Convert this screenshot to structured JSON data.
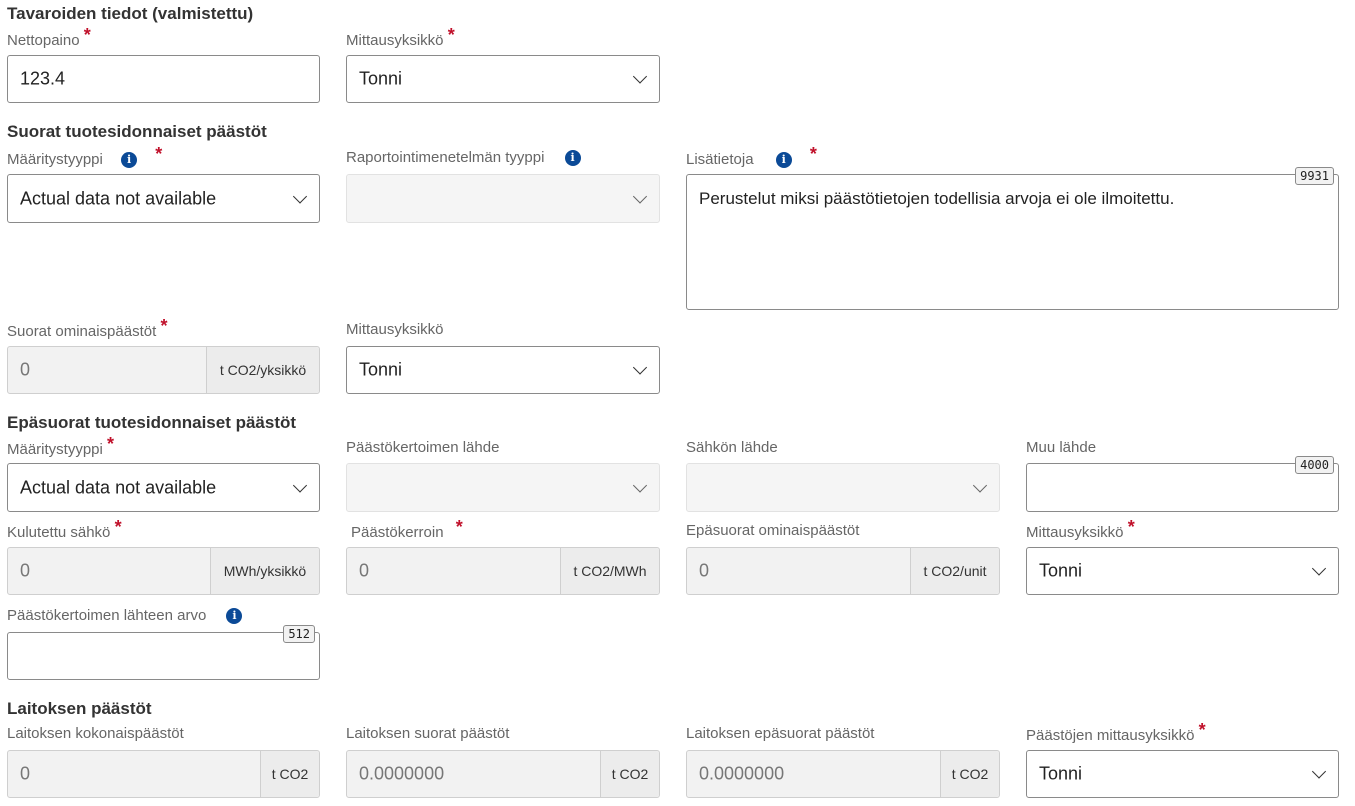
{
  "sections": {
    "goods": {
      "title": "Tavaroiden tiedot (valmistettu)",
      "net_weight_label": "Nettopaino",
      "net_weight_value": "123.4",
      "unit_label": "Mittausyksikkö",
      "unit_value": "Tonni"
    },
    "direct": {
      "title": "Suorat tuotesidonnaiset päästöt",
      "type_label": "Määritystyyppi",
      "type_value": "Actual data not available",
      "reporting_label": "Raportointimenetelmän tyyppi",
      "reporting_value": "",
      "additional_label": "Lisätietoja",
      "additional_value": "Perustelut miksi päästötietojen todellisia arvoja ei ole ilmoitettu.",
      "additional_counter": "9931",
      "specific_label": "Suorat ominaispäästöt",
      "specific_value": "0",
      "specific_unit": "t CO2/yksikkö",
      "unit_label": "Mittausyksikkö",
      "unit_value": "Tonni"
    },
    "indirect": {
      "title": "Epäsuorat tuotesidonnaiset päästöt",
      "type_label": "Määritystyyppi",
      "type_value": "Actual data not available",
      "factor_source_label": "Päästökertoimen lähde",
      "factor_source_value": "",
      "electricity_source_label": "Sähkön lähde",
      "electricity_source_value": "",
      "other_source_label": "Muu lähde",
      "other_source_value": "",
      "other_source_counter": "4000",
      "consumed_label": "Kulutettu sähkö",
      "consumed_value": "0",
      "consumed_unit": "MWh/yksikkö",
      "factor_label": "Päästökerroin",
      "factor_value": "0",
      "factor_unit": "t CO2/MWh",
      "specific_label": "Epäsuorat ominaispäästöt",
      "specific_value": "0",
      "specific_unit": "t CO2/unit",
      "unit_label": "Mittausyksikkö",
      "unit_value": "Tonni",
      "factor_value_source_label": "Päästökertoimen lähteen arvo",
      "factor_value_source_value": "",
      "factor_value_source_counter": "512"
    },
    "facility": {
      "title": "Laitoksen päästöt",
      "total_label": "Laitoksen kokonaispäästöt",
      "total_value": "0",
      "total_unit": "t CO2",
      "direct_label": "Laitoksen suorat päästöt",
      "direct_value": "0.0000000",
      "direct_unit": "t CO2",
      "indirect_label": "Laitoksen epäsuorat päästöt",
      "indirect_value": "0.0000000",
      "indirect_unit": "t CO2",
      "unit_label": "Päästöjen mittausyksikkö",
      "unit_value": "Tonni"
    }
  },
  "icons": {
    "info": "info-icon",
    "required": "*",
    "info_glyph": "i"
  },
  "colors": {
    "required": "#c0102a",
    "info": "#0b4a97"
  }
}
